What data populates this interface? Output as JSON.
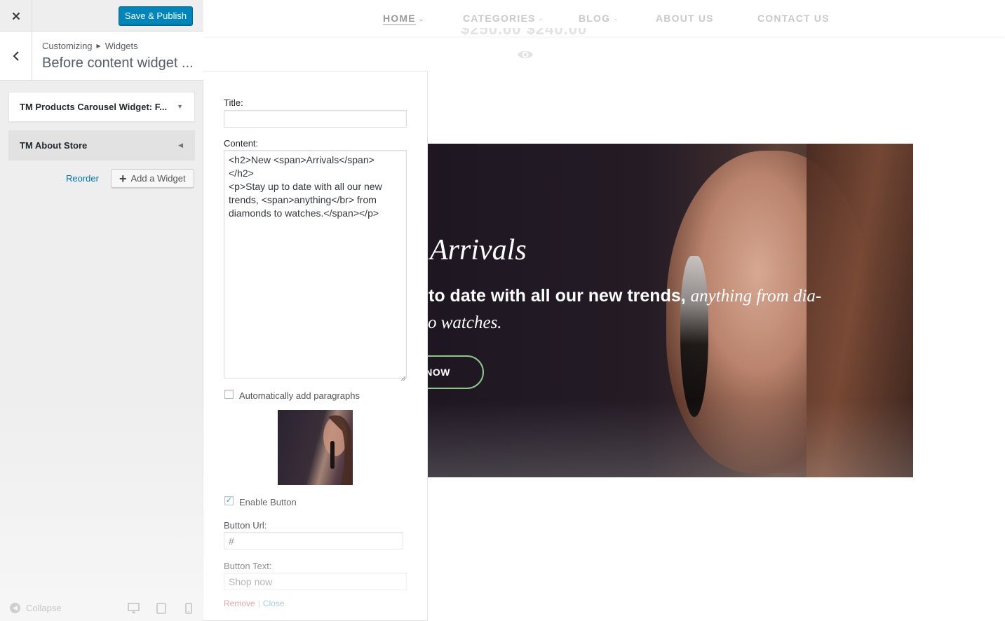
{
  "header": {
    "publish_label": "Save & Publish"
  },
  "section": {
    "breadcrumb_root": "Customizing",
    "breadcrumb_child": "Widgets",
    "title": "Before content widget ..."
  },
  "widgets": [
    {
      "label": "TM Products Carousel Widget: F...",
      "state": "expanded"
    },
    {
      "label": "TM About Store",
      "state": "collapsed"
    }
  ],
  "actions": {
    "reorder_label": "Reorder",
    "add_widget_label": "Add a Widget"
  },
  "footer": {
    "collapse_label": "Collapse",
    "devices": [
      "desktop-icon",
      "tablet-icon",
      "mobile-icon"
    ]
  },
  "form": {
    "title_label": "Title:",
    "title_value": "",
    "content_label": "Content:",
    "content_value": "<h2>New <span>Arrivals</span>\n</h2>\n<p>Stay up to date with all our new trends, <span>anything</br> from diamonds to watches.</span></p>",
    "auto_paragraphs_label": "Automatically add paragraphs",
    "auto_paragraphs_checked": false,
    "enable_button_label": "Enable Button",
    "enable_button_checked": true,
    "button_url_label": "Button Url:",
    "button_url_value": "#",
    "button_text_label": "Button Text:",
    "button_text_value": "Shop now",
    "remove_label": "Remove",
    "separator": "|",
    "close_label": "Close"
  },
  "site": {
    "nav": [
      {
        "label": "HOME",
        "has_dropdown": true,
        "active": true
      },
      {
        "label": "CATEGORIES",
        "has_dropdown": true,
        "active": false
      },
      {
        "label": "BLOG",
        "has_dropdown": true,
        "active": false
      },
      {
        "label": "ABOUT US",
        "has_dropdown": false,
        "active": false
      },
      {
        "label": "CONTACT US",
        "has_dropdown": false,
        "active": false
      }
    ],
    "price_ghost": "$250.00 $240.00",
    "banner": {
      "title": "Arrivals",
      "text_bold": "to date with all our new trends, ",
      "text_italic": "anything from dia-",
      "text_line2": "o watches.",
      "button": "NOW"
    }
  },
  "colors": {
    "primary_button": "#0085ba",
    "link": "#0073aa",
    "banner_button_border": "#8bc98a"
  }
}
